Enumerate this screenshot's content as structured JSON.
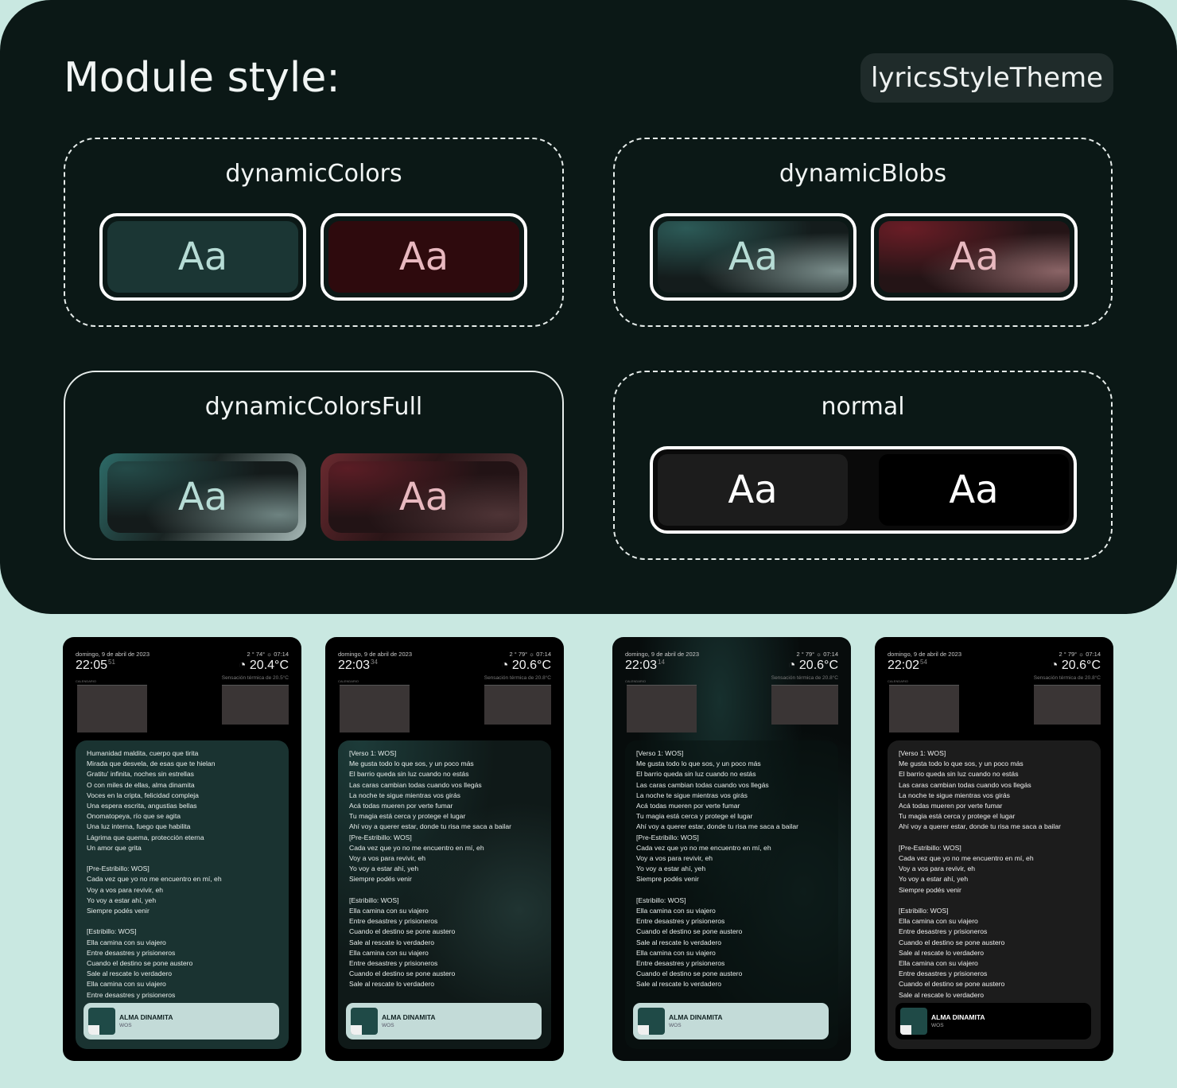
{
  "header": {
    "title": "Module style:",
    "tag": "lyricsStyleTheme"
  },
  "groups": {
    "dynamicColors": {
      "label": "dynamicColors",
      "sample": "Aa"
    },
    "dynamicBlobs": {
      "label": "dynamicBlobs",
      "sample": "Aa"
    },
    "dynamicColorsFull": {
      "label": "dynamicColorsFull",
      "sample": "Aa"
    },
    "normal": {
      "label": "normal",
      "sample": "Aa"
    }
  },
  "colors": {
    "panel": "#0b1816",
    "page": "#c9e8e1",
    "teal": "#1b3634",
    "maroon": "#2e0a0d",
    "grey": "#1c1c1c",
    "black": "#000000"
  },
  "phones": [
    {
      "date": "domingo, 9 de abril de 2023",
      "time": "22:05",
      "sec": "51",
      "status": "2 ° 74° ☼ 07:14",
      "temp": "20.4°C",
      "feel": "Sensación térmica de 20.5°C",
      "calendar": "CALENDARIO",
      "lyrics": "Humanidad maldita, cuerpo que tirita\nMirada que desvela, de esas que te hielan\nGratitu' infinita, noches sin estrellas\nO con miles de ellas, alma dinamita\nVoces en la cripta, felicidad compleja\nUna espera escrita, angustias bellas\nOnomatopeya, río que se agita\nUna luz interna, fuego que habilita\nLágrima que quema, protección eterna\nUn amor que grita\n\n[Pre-Estribillo: WOS]\nCada vez que yo no me encuentro en mí, eh\nVoy a vos para revivir, eh\nYo voy a estar ahí, yeh\nSiempre podés venir\n\n[Estribillo: WOS]\nElla camina con su viajero\nEntre desastres y prisioneros\nCuando el destino se pone austero\nSale al rescate lo verdadero\nElla camina con su viajero\nEntre desastres y prisioneros",
      "song": "ALMA DINAMITA",
      "artist": "WOS"
    },
    {
      "date": "domingo, 9 de abril de 2023",
      "time": "22:03",
      "sec": "34",
      "status": "2 ° 79° ☼ 07:14",
      "temp": "20.6°C",
      "feel": "Sensación térmica de 20.8°C",
      "calendar": "CALENDARIO",
      "lyrics": "[Verso 1: WOS]\nMe gusta todo lo que sos, y un poco más\nEl barrio queda sin luz cuando no estás\nLas caras cambian todas cuando vos llegás\nLa noche te sigue mientras vos girás\nAcá todas mueren por verte fumar\nTu magia está cerca y protege el lugar\nAhí voy a querer estar, donde tu risa me saca a bailar\n[Pre-Estribillo: WOS]\nCada vez que yo no me encuentro en mí, eh\nVoy a vos para revivir, eh\nYo voy a estar ahí, yeh\nSiempre podés venir\n\n[Estribillo: WOS]\nElla camina con su viajero\nEntre desastres y prisioneros\nCuando el destino se pone austero\nSale al rescate lo verdadero\nElla camina con su viajero\nEntre desastres y prisioneros\nCuando el destino se pone austero\nSale al rescate lo verdadero",
      "song": "ALMA DINAMITA",
      "artist": "WOS"
    },
    {
      "date": "domingo, 9 de abril de 2023",
      "time": "22:03",
      "sec": "14",
      "status": "2 ° 79° ☼ 07:14",
      "temp": "20.6°C",
      "feel": "Sensación térmica de 20.8°C",
      "calendar": "CALENDARIO",
      "lyrics": "[Verso 1: WOS]\nMe gusta todo lo que sos, y un poco más\nEl barrio queda sin luz cuando no estás\nLas caras cambian todas cuando vos llegás\nLa noche te sigue mientras vos girás\nAcá todas mueren por verte fumar\nTu magia está cerca y protege el lugar\nAhí voy a querer estar, donde tu risa me saca a bailar\n[Pre-Estribillo: WOS]\nCada vez que yo no me encuentro en mí, eh\nVoy a vos para revivir, eh\nYo voy a estar ahí, yeh\nSiempre podés venir\n\n[Estribillo: WOS]\nElla camina con su viajero\nEntre desastres y prisioneros\nCuando el destino se pone austero\nSale al rescate lo verdadero\nElla camina con su viajero\nEntre desastres y prisioneros\nCuando el destino se pone austero\nSale al rescate lo verdadero",
      "song": "ALMA DINAMITA",
      "artist": "WOS"
    },
    {
      "date": "domingo, 9 de abril de 2023",
      "time": "22:02",
      "sec": "54",
      "status": "2 ° 79° ☼ 07:14",
      "temp": "20.6°C",
      "feel": "Sensación térmica de 20.8°C",
      "calendar": "CALENDARIO",
      "lyrics": "[Verso 1: WOS]\nMe gusta todo lo que sos, y un poco más\nEl barrio queda sin luz cuando no estás\nLas caras cambian todas cuando vos llegás\nLa noche te sigue mientras vos girás\nAcá todas mueren por verte fumar\nTu magia está cerca y protege el lugar\nAhí voy a querer estar, donde tu risa me saca a bailar\n\n[Pre-Estribillo: WOS]\nCada vez que yo no me encuentro en mí, eh\nVoy a vos para revivir, eh\nYo voy a estar ahí, yeh\nSiempre podés venir\n\n[Estribillo: WOS]\nElla camina con su viajero\nEntre desastres y prisioneros\nCuando el destino se pone austero\nSale al rescate lo verdadero\nElla camina con su viajero\nEntre desastres y prisioneros\nCuando el destino se pone austero\nSale al rescate lo verdadero",
      "song": "ALMA DINAMITA",
      "artist": "WOS"
    }
  ]
}
